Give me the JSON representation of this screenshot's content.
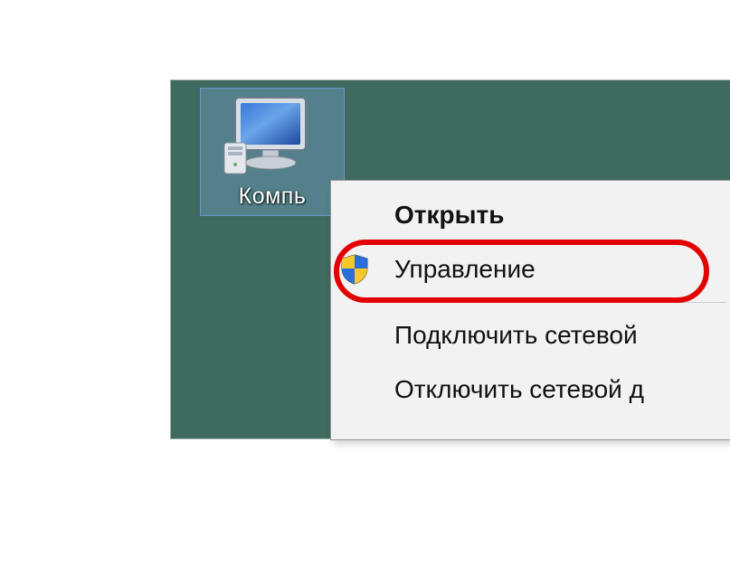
{
  "desktop": {
    "icon_label": "Компь"
  },
  "context_menu": {
    "items": {
      "open": "Открыть",
      "manage": "Управление",
      "map_drive": "Подключить сетевой ",
      "disconnect_drive": "Отключить сетевой д"
    }
  }
}
